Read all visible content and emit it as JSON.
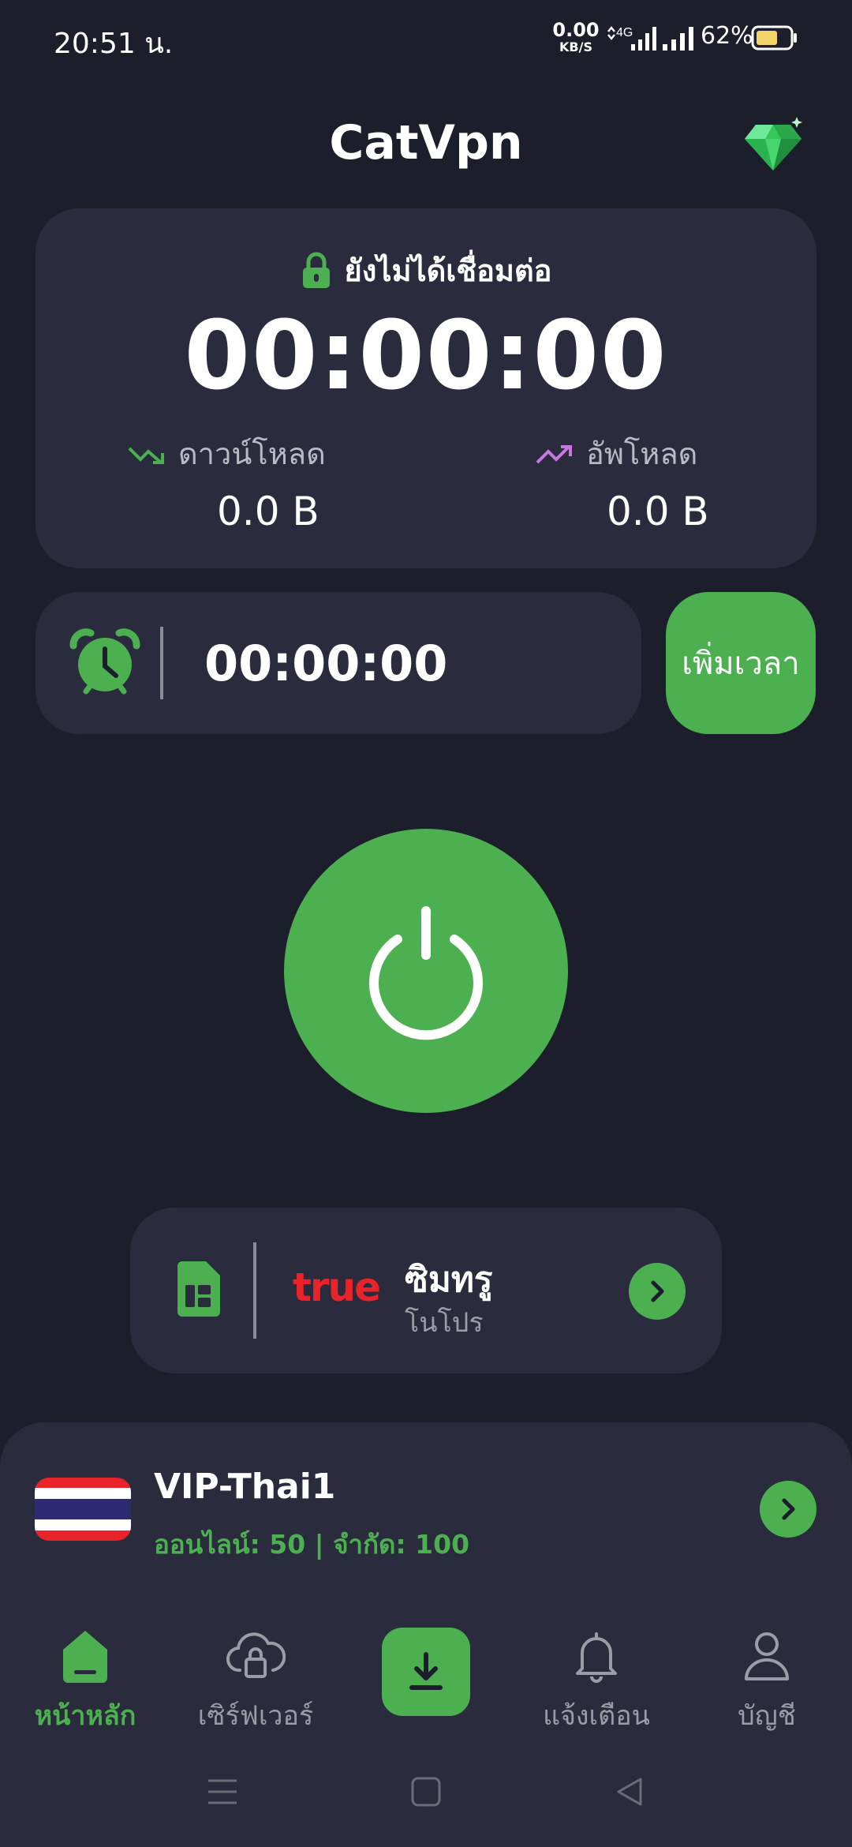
{
  "status_bar": {
    "time": "20:51 น.",
    "net_speed_value": "0.00",
    "net_speed_unit": "KB/S",
    "network_type": "4G",
    "battery_percent": "62%"
  },
  "header": {
    "title": "CatVpn",
    "premium_icon": "gem-icon"
  },
  "connection": {
    "status": "ยังไม่ได้เชื่อมต่อ",
    "elapsed": "00:00:00",
    "download_label": "ดาวน์โหลด",
    "download_value": "0.0 B",
    "upload_label": "อัพโหลด",
    "upload_value": "0.0 B"
  },
  "time_quota": {
    "remaining": "00:00:00",
    "add_time_label": "เพิ่มเวลา"
  },
  "sim": {
    "carrier_logo": "true",
    "name": "ซิมทรู",
    "plan": "โนโปร"
  },
  "server": {
    "name": "VIP-Thai1",
    "info": "ออนไลน์: 50 | จำกัด: 100"
  },
  "tabs": [
    {
      "label": "หน้าหลัก",
      "icon": "home-icon",
      "active": true
    },
    {
      "label": "เซิร์ฟเวอร์",
      "icon": "cloud-lock-icon",
      "active": false
    },
    {
      "label": "",
      "icon": "download-icon",
      "active": false
    },
    {
      "label": "แจ้งเตือน",
      "icon": "bell-icon",
      "active": false
    },
    {
      "label": "บัญชี",
      "icon": "user-icon",
      "active": false
    }
  ],
  "colors": {
    "background": "#1c1e2b",
    "card": "#2a2c3d",
    "accent": "#4caf50",
    "upload_accent": "#c678dd",
    "carrier_red": "#e8232a"
  }
}
